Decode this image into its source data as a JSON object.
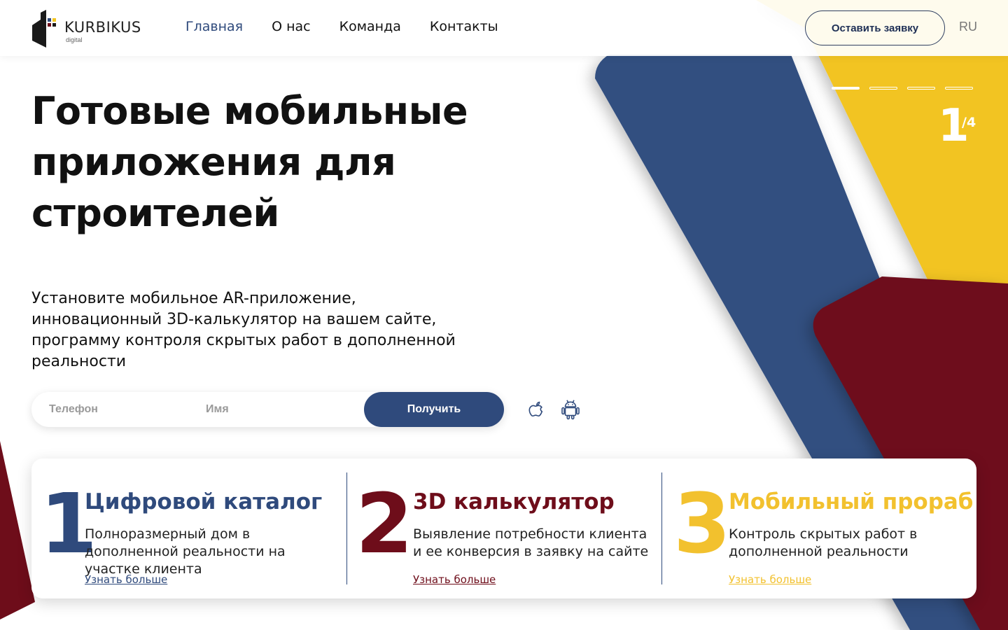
{
  "brand": {
    "name": "KURBIKUS",
    "sub": "digital"
  },
  "nav": {
    "items": [
      {
        "label": "Главная",
        "active": true
      },
      {
        "label": "О нас",
        "active": false
      },
      {
        "label": "Команда",
        "active": false
      },
      {
        "label": "Контакты",
        "active": false
      }
    ],
    "cta_label": "Оставить заявку",
    "lang": "RU"
  },
  "hero": {
    "title": "Готовые мобильные приложения для строителей",
    "description": "Установите мобильное AR-приложение, инновационный 3D-калькулятор на вашем сайте, программу контроля скрытых работ в дополненной реальности"
  },
  "form": {
    "phone_placeholder": "Телефон",
    "name_placeholder": "Имя",
    "submit_label": "Получить"
  },
  "store_icons": [
    "apple-icon",
    "android-icon"
  ],
  "slider": {
    "current": "1",
    "total": "/4",
    "total_slides": 4,
    "active_index": 0
  },
  "features": [
    {
      "number": "1",
      "title": "Цифровой каталог",
      "description": "Полноразмерный дом в дополненной реальности на участке клиента",
      "link": "Узнать больше",
      "color": "#2f4a7c"
    },
    {
      "number": "2",
      "title": "3D калькулятор",
      "description": "Выявление потребности клиента и ее конверсия в заявку на сайте",
      "link": "Узнать больше",
      "color": "#6e0d1a"
    },
    {
      "number": "3",
      "title": "Мобильный прораб",
      "description": "Контроль скрытых работ в дополненной реальности",
      "link": "Узнать больше",
      "color": "#f2c12e"
    }
  ],
  "colors": {
    "blue": "#324f80",
    "yellow": "#f2c420",
    "burgundy": "#6e0d1a",
    "accent": "#2f4a7c"
  }
}
